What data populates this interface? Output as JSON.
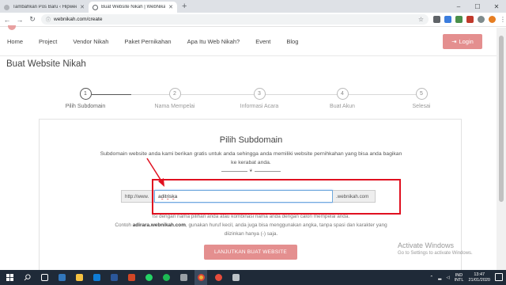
{
  "browser": {
    "tabs": [
      {
        "title": "Tambahkan Pos Baru ‹ Hipwee —",
        "active": false
      },
      {
        "title": "Buat Website Nikah | WebNikah.com",
        "active": true
      }
    ],
    "new_tab": "+",
    "url": "webnikah.com/create",
    "controls": {
      "minimize": "–",
      "maximize": "☐",
      "close": "✕"
    }
  },
  "site": {
    "nav": [
      "Home",
      "Project",
      "Vendor Nikah",
      "Paket Pernikahan",
      "Apa Itu Web Nikah?",
      "Event",
      "Blog"
    ],
    "login_label": "Login",
    "page_title": "Buat Website Nikah"
  },
  "wizard": {
    "steps": [
      {
        "num": "1",
        "label": "Pilih Subdomain",
        "active": true
      },
      {
        "num": "2",
        "label": "Nama Mempelai",
        "active": false
      },
      {
        "num": "3",
        "label": "Informasi Acara",
        "active": false
      },
      {
        "num": "4",
        "label": "Buat Akun",
        "active": false
      },
      {
        "num": "5",
        "label": "Selesai",
        "active": false
      }
    ]
  },
  "form": {
    "title": "Pilih Subdomain",
    "description": "Subdomain website anda kami berikan gratis untuk anda sehingga anda memiliki website pernihkahan yang bisa anda bagikan ke kerabat anda.",
    "prefix": "http://www.",
    "subdomain_value": "aditriska",
    "suffix": ".webnikah.com",
    "help_line1": "Isi dengan nama pilihan anda atau kombinasi nama anda dengan calon mempelai anda.",
    "help_line2_pre": "Contoh",
    "help_example": "adirara.webnikah.com",
    "help_line2_post": ", gunakan huruf kecil, anda juga bisa menggunakan angka, tanpa spasi dan karakter yang diizinkan hanya (-) saja.",
    "submit_label": "LANJUTKAN BUAT WEBSITE"
  },
  "watermark": {
    "title": "Activate Windows",
    "subtitle": "Go to Settings to activate Windows."
  },
  "taskbar": {
    "lang1": "IND",
    "lang2": "INTL",
    "time": "13:47",
    "date": "21/01/2020"
  },
  "colors": {
    "accent": "#e48f8f",
    "annotation": "#e01020",
    "taskbar": "#1f2a38"
  }
}
